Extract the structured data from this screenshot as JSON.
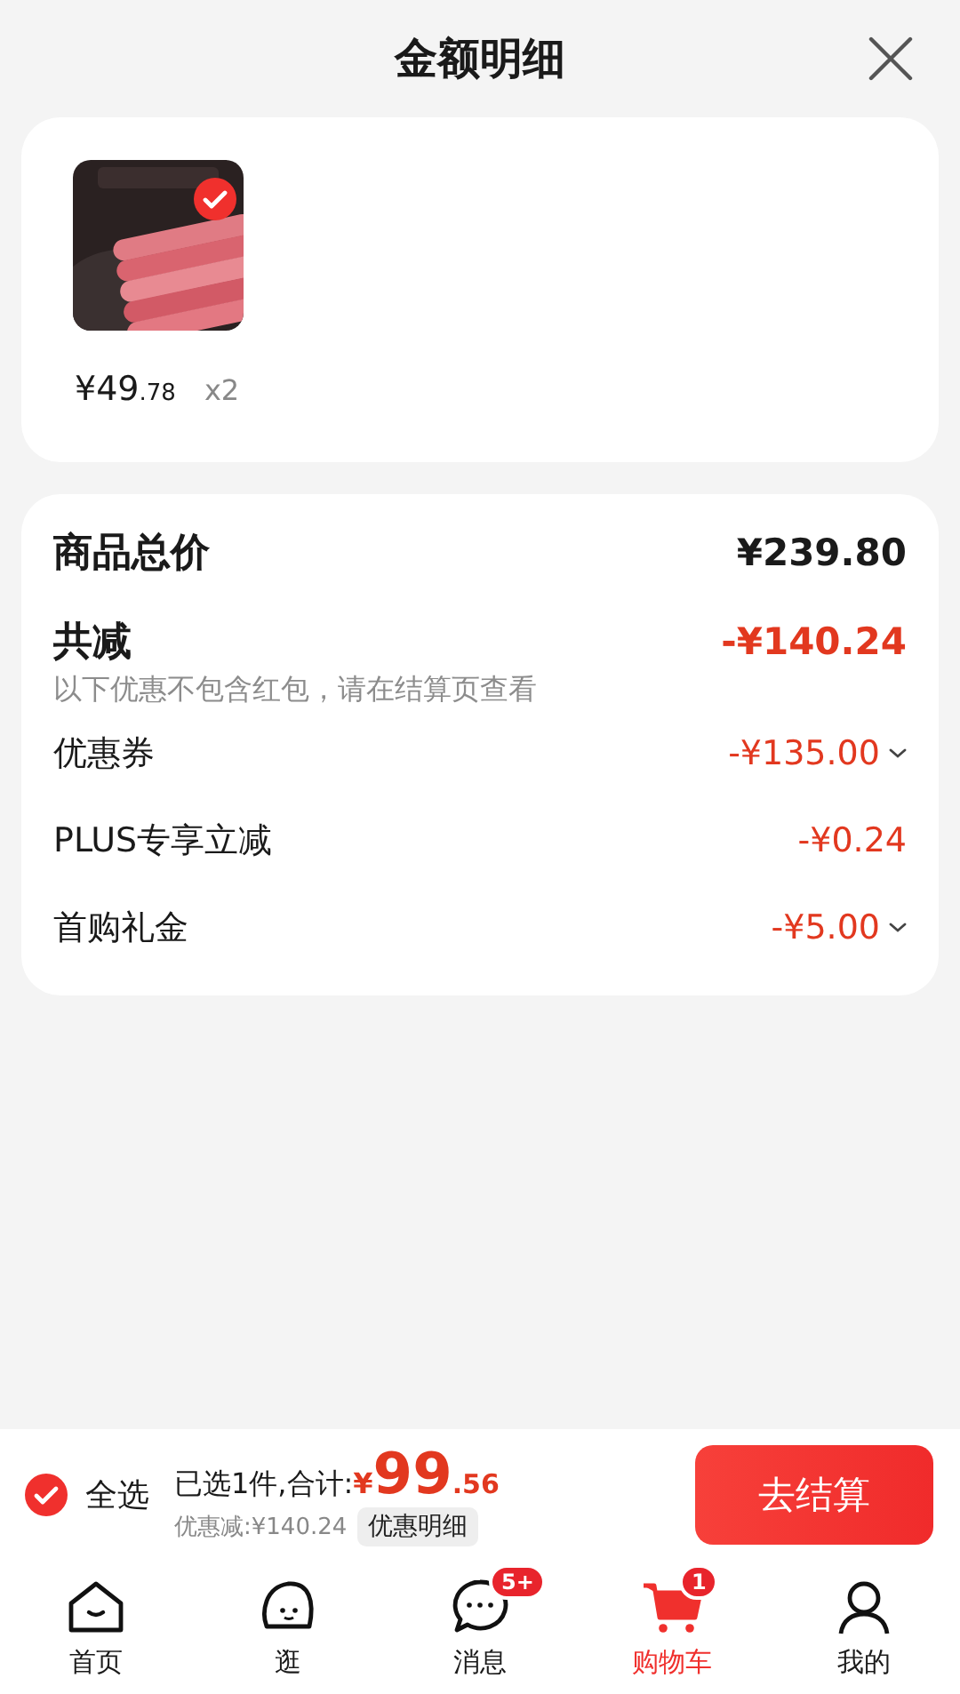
{
  "header": {
    "title": "金额明细"
  },
  "product": {
    "checked": true,
    "price_main": "¥49",
    "price_decimal": ".78",
    "quantity": "x2"
  },
  "summary": {
    "total_label": "商品总价",
    "total_value": "¥239.80",
    "reduce_label": "共减",
    "reduce_value": "-¥140.24",
    "reduce_note": "以下优惠不包含红包，请在结算页查看",
    "discounts": [
      {
        "label": "优惠券",
        "value": "-¥135.00",
        "expandable": true
      },
      {
        "label": "PLUS专享立减",
        "value": "-¥0.24",
        "expandable": false
      },
      {
        "label": "首购礼金",
        "value": "-¥5.00",
        "expandable": true
      }
    ]
  },
  "checkout_bar": {
    "select_all": {
      "label": "全选",
      "checked": true
    },
    "selected_text": "已选1件,合计:",
    "currency": "¥",
    "total_main": "99",
    "total_decimal": ".56",
    "discount_text": "优惠减:¥140.24",
    "detail_button": "优惠明细",
    "checkout_button": "去结算"
  },
  "tab_bar": [
    {
      "kind": "home",
      "label": "首页",
      "selected": false
    },
    {
      "kind": "browse",
      "label": "逛",
      "selected": false
    },
    {
      "kind": "message",
      "label": "消息",
      "selected": false,
      "badge": "5+"
    },
    {
      "kind": "cart",
      "label": "购物车",
      "selected": true,
      "badge": "1"
    },
    {
      "kind": "profile",
      "label": "我的",
      "selected": false
    }
  ]
}
